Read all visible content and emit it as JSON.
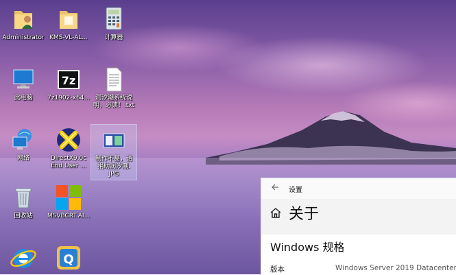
{
  "desktop": {
    "icons": [
      {
        "label": "Administrator",
        "icon": "user-folder-icon"
      },
      {
        "label": "KMS-VL-AL...",
        "icon": "folder-icon"
      },
      {
        "label": "计算器",
        "icon": "calculator-icon"
      },
      {
        "label": "此电脑",
        "icon": "computer-icon"
      },
      {
        "label": "7z1902-x64...",
        "icon": "7zip-icon"
      },
      {
        "label": "润汐潮系统说\n明，必读！.txt",
        "icon": "text-file-icon"
      },
      {
        "label": "网络",
        "icon": "network-icon"
      },
      {
        "label": "DirectX9.0c\nEnd User ...",
        "icon": "directx-icon"
      },
      {
        "label": "制作不易，请\n捐助润汐潮.\nJPG",
        "icon": "image-file-icon"
      },
      {
        "label": "回收站",
        "icon": "recycle-bin-icon"
      },
      {
        "label": "MSVBCRT.AI...",
        "icon": "windows-logo-icon"
      },
      {
        "label": "",
        "icon": "internet-explorer-icon"
      },
      {
        "label": "",
        "icon": "app-q-icon"
      }
    ]
  },
  "settings": {
    "window_title": "设置",
    "back_icon": "back-arrow-icon",
    "page_heading": "关于",
    "section_title": "Windows 规格",
    "spec_key": "版本",
    "spec_value": "Windows Server 2019 Datacenter"
  }
}
